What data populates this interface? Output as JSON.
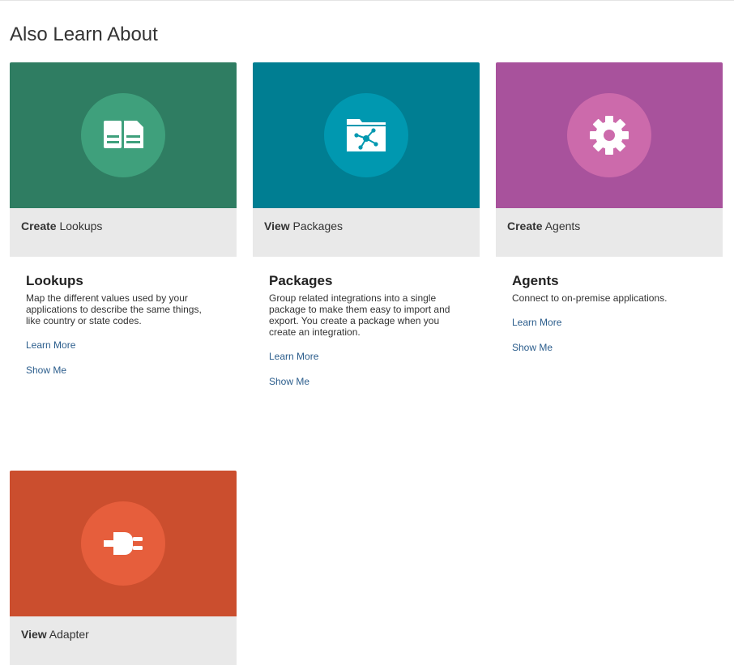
{
  "section": {
    "title": "Also Learn About"
  },
  "cards": [
    {
      "hero_color": "#2f7d62",
      "circle_color": "#3fa07c",
      "icon": "lookups-document-icon",
      "action_verb": "Create",
      "action_noun": "Lookups",
      "title": "Lookups",
      "description": "Map the different values used by your applications to describe the same things, like country or state codes.",
      "learn_more": "Learn More",
      "show_me": "Show Me"
    },
    {
      "hero_color": "#007e92",
      "circle_color": "#0098b0",
      "icon": "package-folder-icon",
      "action_verb": "View",
      "action_noun": "Packages",
      "title": "Packages",
      "description": "Group related integrations into a single package to make them easy to import and export. You create a package when you create an integration.",
      "learn_more": "Learn More",
      "show_me": "Show Me"
    },
    {
      "hero_color": "#a8529c",
      "circle_color": "#cc6aab",
      "icon": "gear-icon",
      "action_verb": "Create",
      "action_noun": "Agents",
      "title": "Agents",
      "description": "Connect to on-premise applications.",
      "learn_more": "Learn More",
      "show_me": "Show Me"
    },
    {
      "hero_color": "#cb4e2e",
      "circle_color": "#e65e3c",
      "icon": "plug-icon",
      "action_verb": "View",
      "action_noun": "Adapter"
    }
  ]
}
